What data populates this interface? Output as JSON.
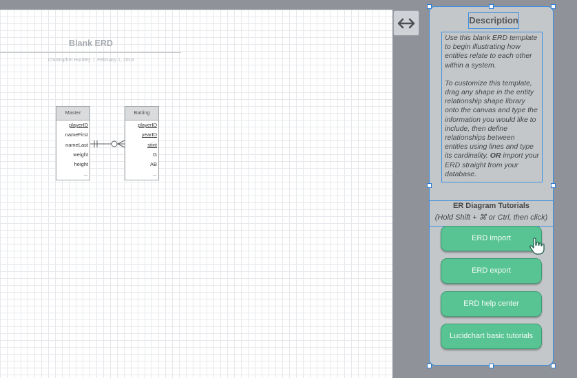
{
  "diagram": {
    "title": "Blank ERD",
    "author": "Christopher Huntley",
    "date": "February 1, 2019",
    "entities": [
      {
        "name": "Master",
        "fields": [
          {
            "label": "playerID",
            "key": true
          },
          {
            "label": "nameFirst",
            "key": false
          },
          {
            "label": "nameLast",
            "key": false
          },
          {
            "label": "weight",
            "key": false
          },
          {
            "label": "height",
            "key": false
          },
          {
            "label": "...",
            "key": false
          }
        ]
      },
      {
        "name": "Batting",
        "fields": [
          {
            "label": "playerID",
            "key": true
          },
          {
            "label": "yearID",
            "key": true
          },
          {
            "label": "stint",
            "key": true
          },
          {
            "label": "G",
            "key": false
          },
          {
            "label": "AB",
            "key": false
          },
          {
            "label": "...",
            "key": false
          }
        ]
      }
    ],
    "relationship": {
      "from": "Master",
      "to": "Batting",
      "cardinality": "one-to-zero-or-many"
    }
  },
  "panel": {
    "toggle_icon": "double-arrow-icon",
    "description_title": "Description",
    "description_p1": "Use this blank ERD template to begin illustrating how entities relate to each other within a system.",
    "description_p2_a": "To customize this template, drag any shape in the entity relationship shape library onto the canvas and type the information you would like to include, then define relationships between entities using lines and type its cardinality. ",
    "description_p2_or": "OR",
    "description_p2_b": " import your ERD straight from your database.",
    "tutorials_title": "ER Diagram Tutorials",
    "tutorials_hint": "(Hold Shift + ⌘ or Ctrl, then click)",
    "buttons": [
      {
        "label": "ERD import"
      },
      {
        "label": "ERD export"
      },
      {
        "label": "ERD help center"
      },
      {
        "label": "Lucidchart basic tutorials"
      }
    ]
  },
  "colors": {
    "selection": "#3d8fe0",
    "button": "#59c493",
    "panel": "#c4c7ca"
  }
}
